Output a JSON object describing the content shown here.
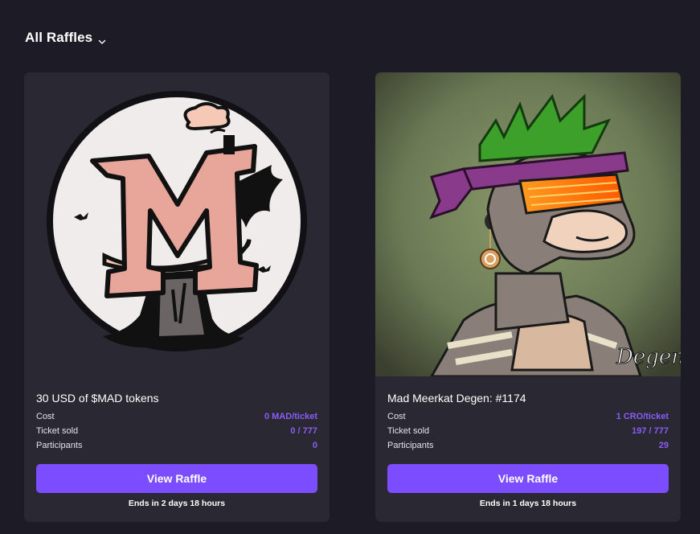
{
  "header": {
    "title": "All Raffles",
    "chevron_icon": "chevron-down-icon"
  },
  "raffles": [
    {
      "name": "30 USD of $MAD tokens",
      "image_icon": "mad-token-logo",
      "cost_label": "Cost",
      "cost_value": "0 MAD/ticket",
      "sold_label": "Ticket sold",
      "sold_value": "0 / 777",
      "participants_label": "Participants",
      "participants_value": "0",
      "button_label": "View Raffle",
      "ends_text": "Ends in 2 days 18 hours"
    },
    {
      "name": "Mad Meerkat Degen: #1174",
      "image_icon": "meerkat-degen-nft",
      "image_signature": "Degen",
      "cost_label": "Cost",
      "cost_value": "1 CRO/ticket",
      "sold_label": "Ticket sold",
      "sold_value": "197 / 777",
      "participants_label": "Participants",
      "participants_value": "29",
      "button_label": "View Raffle",
      "ends_text": "Ends in 1 days 18 hours"
    }
  ],
  "colors": {
    "background": "#1d1b26",
    "card": "#2a2832",
    "accent": "#7c4dff",
    "value": "#8b5cf6"
  }
}
